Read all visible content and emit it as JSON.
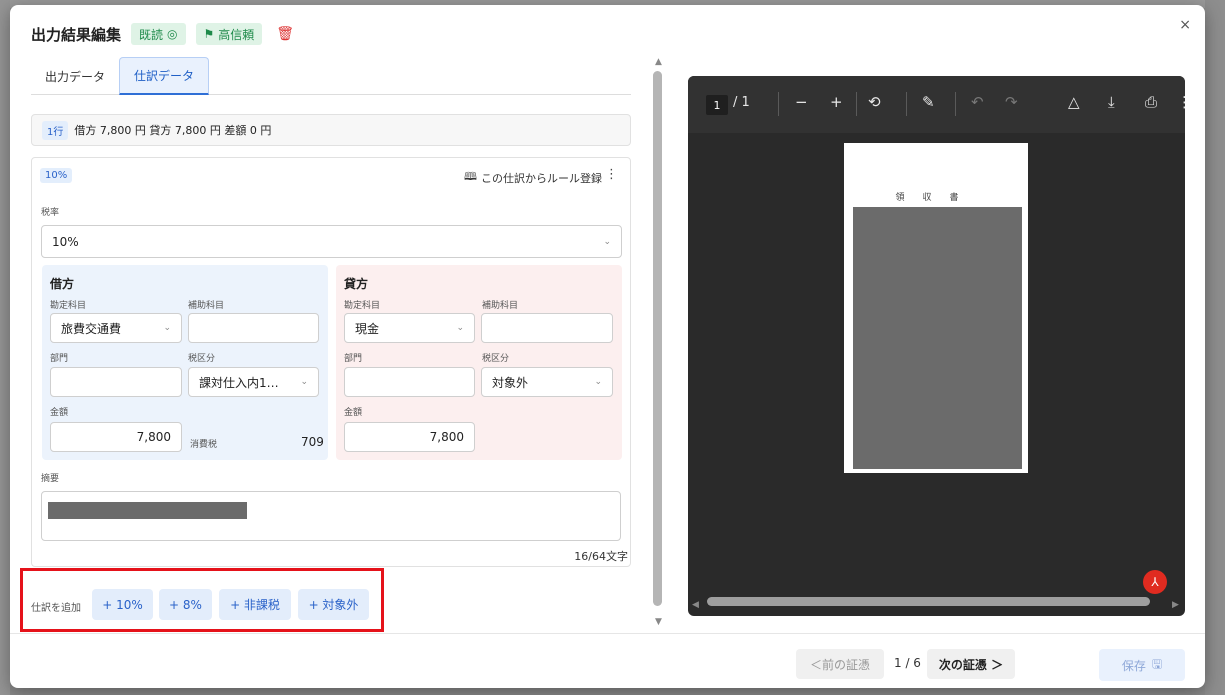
{
  "header": {
    "title": "出力結果編集",
    "badge_read": "既読",
    "badge_trust": "高信頼"
  },
  "tabs": [
    {
      "label": "出力データ"
    },
    {
      "label": "仕訳データ"
    }
  ],
  "summary": {
    "rows_chip": "1行",
    "text": "借方 7,800 円  貸方 7,800 円  差額 0 円"
  },
  "entry": {
    "tax_chip": "10%",
    "rule_link": "この仕訳からルール登録",
    "tax_rate_label": "税率",
    "tax_rate_value": "10%",
    "debit": {
      "title": "借方",
      "account_label": "勘定科目",
      "account_value": "旅費交通費",
      "sub_label": "補助科目",
      "sub_value": "",
      "dept_label": "部門",
      "dept_value": "",
      "taxcat_label": "税区分",
      "taxcat_value": "課対仕入内1…",
      "amount_label": "金額",
      "amount_value": "7,800",
      "ctax_label": "消費税",
      "ctax_value": "709"
    },
    "credit": {
      "title": "貸方",
      "account_label": "勘定科目",
      "account_value": "現金",
      "sub_label": "補助科目",
      "sub_value": "",
      "dept_label": "部門",
      "dept_value": "",
      "taxcat_label": "税区分",
      "taxcat_value": "対象外",
      "amount_label": "金額",
      "amount_value": "7,800"
    },
    "memo_label": "摘要",
    "char_count": "16/64文字"
  },
  "add_entry": {
    "label": "仕訳を追加",
    "buttons": [
      "+ 10%",
      "+ 8%",
      "+ 非課税",
      "+ 対象外"
    ]
  },
  "pdf": {
    "page_current": "1",
    "page_total": "/ 1",
    "page_heading": "領収書"
  },
  "footer": {
    "prev_label": "＜前の証憑",
    "page_count": "1 / 6",
    "next_label": "次の証憑 ＞",
    "save_label": "保存"
  },
  "colors": {
    "accent": "#2f6fd6",
    "highlight": "#e5121a",
    "badge_green": "#1e8a4a"
  }
}
